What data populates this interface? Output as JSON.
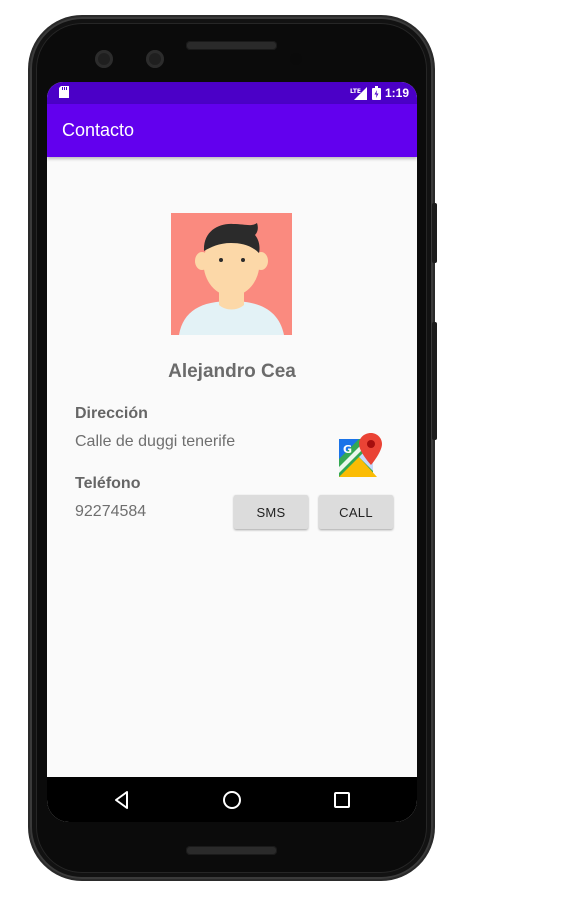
{
  "status_bar": {
    "time": "1:19",
    "network": "LTE",
    "icons": [
      "sd-card-icon",
      "lte-signal-icon",
      "battery-icon"
    ]
  },
  "app_bar": {
    "title": "Contacto"
  },
  "contact": {
    "name": "Alejandro Cea",
    "address_label": "Dirección",
    "address": "Calle de duggi tenerife",
    "phone_label": "Teléfono",
    "phone": "92274584"
  },
  "actions": {
    "sms_label": "SMS",
    "call_label": "CALL"
  },
  "nav": {
    "items": [
      "back-icon",
      "home-icon",
      "recents-icon"
    ]
  },
  "colors": {
    "status_bar": "#4b00c7",
    "app_bar": "#6200ee",
    "background": "#fafafa",
    "button": "#dcdcdc",
    "avatar_bg": "#fa8a7f"
  }
}
